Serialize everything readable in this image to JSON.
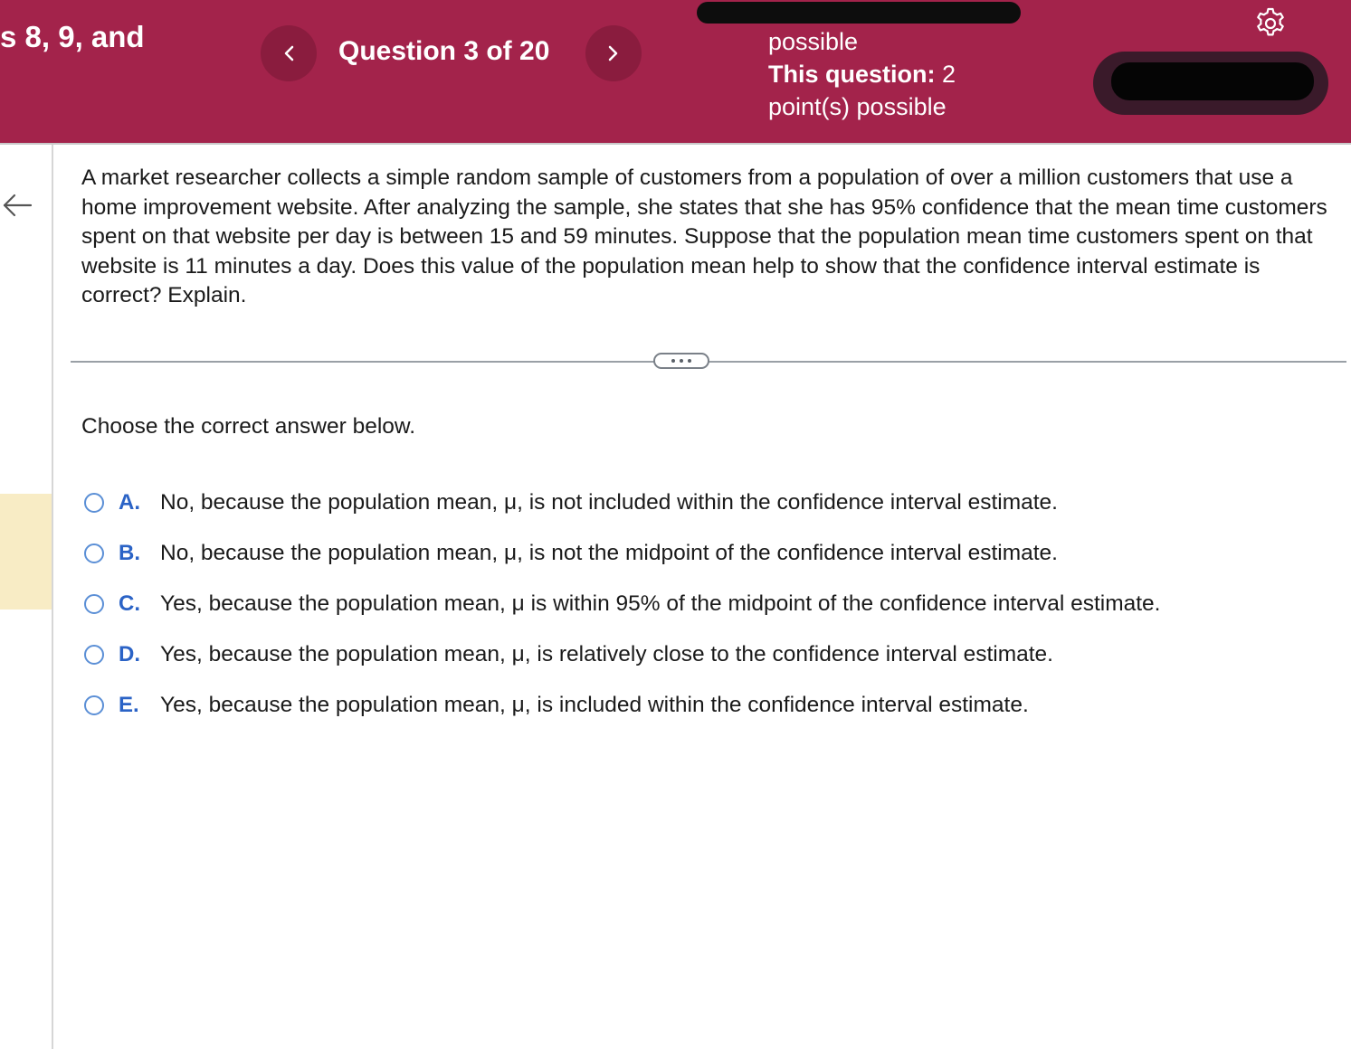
{
  "header": {
    "assignment_title_fragment": "s 8, 9, and",
    "prev_icon": "chevron-left-icon",
    "next_icon": "chevron-right-icon",
    "question_counter": "Question 3 of 20",
    "points_partial": "possible",
    "points_label": "This question:",
    "points_value": "2",
    "points_suffix": "point(s) possible",
    "settings_icon": "gear-icon",
    "accent_color": "#a3234b"
  },
  "left_rail": {
    "back_icon": "arrow-left-icon",
    "highlight_color": "#f8ecc5"
  },
  "question": {
    "text": "A market researcher collects a simple random sample of customers from a population of over a million customers that use a home improvement website. After analyzing the sample, she states that she has 95% confidence that the mean time customers spent on that website per day is between 15 and 59 minutes. Suppose that the population mean time customers spent on that website is 11 minutes a day. Does this value of the population mean help to show that the confidence interval estimate is correct? Explain.",
    "more_icon": "ellipsis-icon"
  },
  "prompt": "Choose the correct answer below.",
  "options": [
    {
      "letter": "A.",
      "text": "No, because the population mean, μ, is not included within the confidence interval estimate."
    },
    {
      "letter": "B.",
      "text": "No, because the population mean, μ, is not the midpoint of the confidence interval estimate."
    },
    {
      "letter": "C.",
      "text": "Yes, because the population mean, μ is within 95% of the midpoint of the confidence interval estimate."
    },
    {
      "letter": "D.",
      "text": "Yes, because the population mean, μ, is relatively close to the confidence interval estimate."
    },
    {
      "letter": "E.",
      "text": "Yes, because the population mean, μ, is included within the confidence interval estimate."
    }
  ]
}
